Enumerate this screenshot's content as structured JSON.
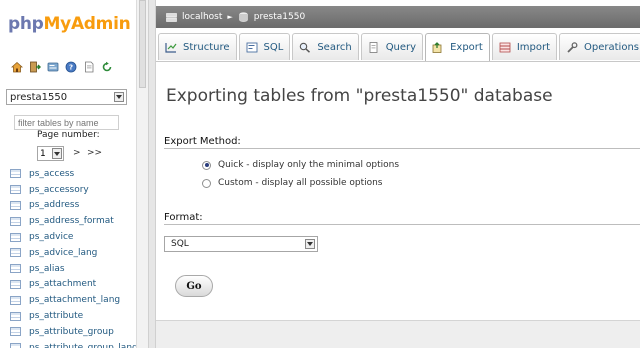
{
  "logo": {
    "php": "php",
    "my": "My",
    "admin": "Admin"
  },
  "nav": {
    "quick_icons": [
      "home-icon",
      "exit-icon",
      "sql-query-icon",
      "help-icon",
      "docs-icon",
      "reload-icon"
    ],
    "database_select": {
      "value": "presta1550"
    },
    "filter": {
      "placeholder": "filter tables by name"
    },
    "page_number_label": "Page number:",
    "page_select": {
      "value": "1"
    },
    "page_next": ">",
    "page_last": ">>",
    "tables": [
      "ps_access",
      "ps_accessory",
      "ps_address",
      "ps_address_format",
      "ps_advice",
      "ps_advice_lang",
      "ps_alias",
      "ps_attachment",
      "ps_attachment_lang",
      "ps_attribute",
      "ps_attribute_group",
      "ps_attribute_group_lang"
    ]
  },
  "breadcrumb": {
    "server": "localhost",
    "database": "presta1550"
  },
  "tabs": [
    {
      "label": "Structure",
      "icon": "structure-icon"
    },
    {
      "label": "SQL",
      "icon": "sql-icon"
    },
    {
      "label": "Search",
      "icon": "search-icon"
    },
    {
      "label": "Query",
      "icon": "query-icon"
    },
    {
      "label": "Export",
      "icon": "export-icon",
      "active": true
    },
    {
      "label": "Import",
      "icon": "import-icon"
    },
    {
      "label": "Operations",
      "icon": "operations-icon"
    }
  ],
  "main": {
    "title": "Exporting tables from \"presta1550\" database",
    "export_method_label": "Export Method:",
    "radio_quick": "Quick - display only the minimal options",
    "radio_custom": "Custom - display all possible options",
    "format_label": "Format:",
    "format_value": "SQL",
    "go_label": "Go"
  },
  "colors": {
    "link": "#235a81",
    "breadcrumb_bg": "#6b6b6b",
    "logo_php": "#6c78af",
    "logo_myadmin": "#f89c0e"
  }
}
